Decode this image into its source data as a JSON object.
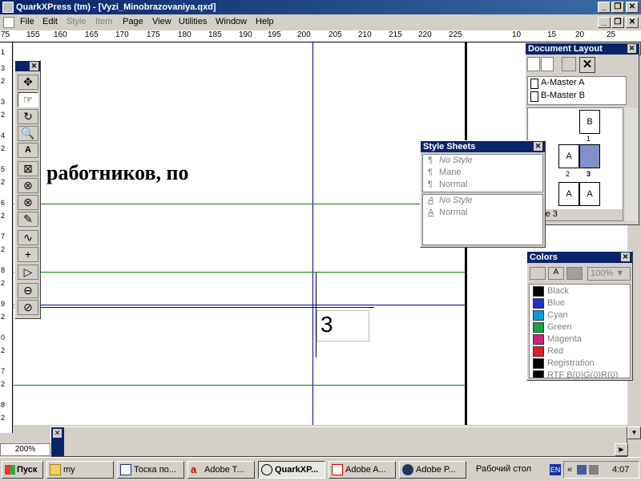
{
  "window": {
    "title": "QuarkXPress (tm) - [Vyzi_Minobrazovaniya.qxd]",
    "min": "_",
    "restore": "❐",
    "close": "✕"
  },
  "menu": [
    {
      "label": "File",
      "enabled": true
    },
    {
      "label": "Edit",
      "enabled": true
    },
    {
      "label": "Style",
      "enabled": false
    },
    {
      "label": "Item",
      "enabled": false
    },
    {
      "label": "Page",
      "enabled": true
    },
    {
      "label": "View",
      "enabled": true
    },
    {
      "label": "Utilities",
      "enabled": true
    },
    {
      "label": "Window",
      "enabled": true
    },
    {
      "label": "Help",
      "enabled": true
    }
  ],
  "ruler": {
    "h_labels": [
      "75",
      "155",
      "160",
      "165",
      "170",
      "175",
      "180",
      "185",
      "190",
      "195",
      "200",
      "205",
      "210",
      "215",
      "220",
      "225",
      "10",
      "15",
      "20",
      "25"
    ],
    "v_labels": [
      "1",
      "3",
      "2",
      "3",
      "2",
      "4",
      "2",
      "5",
      "2",
      "6",
      "2",
      "7",
      "2",
      "8",
      "2",
      "9",
      "2",
      "0",
      "2",
      "7",
      "2",
      "8",
      "2",
      "9",
      "2"
    ]
  },
  "document": {
    "body_text": "работников, по",
    "page_number": "3"
  },
  "tools": [
    {
      "icon": "item-tool-icon",
      "glyph": "✥"
    },
    {
      "icon": "content-hand-tool-icon",
      "glyph": "☞"
    },
    {
      "icon": "rotate-tool-icon",
      "glyph": "↻"
    },
    {
      "icon": "zoom-tool-icon",
      "glyph": "🔍"
    },
    {
      "icon": "text-box-tool-icon",
      "glyph": "A"
    },
    {
      "icon": "picture-box-tool-icon",
      "glyph": "⊠"
    },
    {
      "icon": "oval-picture-box-icon",
      "glyph": "⊗"
    },
    {
      "icon": "circle-picture-box-icon",
      "glyph": "⊗"
    },
    {
      "icon": "bezier-picture-box-icon",
      "glyph": "✎"
    },
    {
      "icon": "freehand-line-tool-icon",
      "glyph": "∿"
    },
    {
      "icon": "orthogonal-line-tool-icon",
      "glyph": "+"
    },
    {
      "icon": "text-path-tool-icon",
      "glyph": "▷"
    },
    {
      "icon": "link-tool-icon",
      "glyph": "⊖"
    },
    {
      "icon": "unlink-tool-icon",
      "glyph": "⊘"
    }
  ],
  "document_layout": {
    "title": "Document Layout",
    "masters": [
      "A-Master A",
      "B-Master B"
    ],
    "page_labels": [
      "B",
      "1",
      "A",
      "2",
      "3",
      "A",
      "A"
    ],
    "footer": "Page 3"
  },
  "style_sheets": {
    "title": "Style Sheets",
    "paragraph": [
      {
        "sym": "¶",
        "label": "No Style",
        "italic": true
      },
      {
        "sym": "¶",
        "label": "Mane",
        "italic": false
      },
      {
        "sym": "¶",
        "label": "Normal",
        "italic": false
      }
    ],
    "character": [
      {
        "sym": "A",
        "label": "No Style",
        "italic": true
      },
      {
        "sym": "A",
        "label": "Normal",
        "italic": false
      }
    ]
  },
  "colors": {
    "title": "Colors",
    "tint": "100%",
    "items": [
      {
        "label": "Black",
        "color": "#000000"
      },
      {
        "label": "Blue",
        "color": "#2030c8"
      },
      {
        "label": "Cyan",
        "color": "#00a0e0"
      },
      {
        "label": "Green",
        "color": "#20a040"
      },
      {
        "label": "Magenta",
        "color": "#d02080"
      },
      {
        "label": "Red",
        "color": "#e02020"
      },
      {
        "label": "Registration",
        "color": "#000000"
      },
      {
        "label": "RTF B(0)G(0)R(0)",
        "color": "#000000"
      }
    ]
  },
  "zoom": "200%",
  "taskbar": {
    "start": "Пуск",
    "tasks": [
      {
        "label": "my",
        "icon": "folder-icon",
        "active": false
      },
      {
        "label": "Тоска по...",
        "icon": "window-icon",
        "active": false
      },
      {
        "label": "Adobe T...",
        "icon": "acrobat-icon",
        "active": false
      },
      {
        "label": "QuarkXP...",
        "icon": "quark-icon",
        "active": true
      },
      {
        "label": "Adobe A...",
        "icon": "acrobat-doc-icon",
        "active": false
      },
      {
        "label": "Adobe P...",
        "icon": "photoshop-icon",
        "active": false
      }
    ],
    "desktop": "Рабочий стол",
    "lang": "EN",
    "time": "4:07"
  }
}
